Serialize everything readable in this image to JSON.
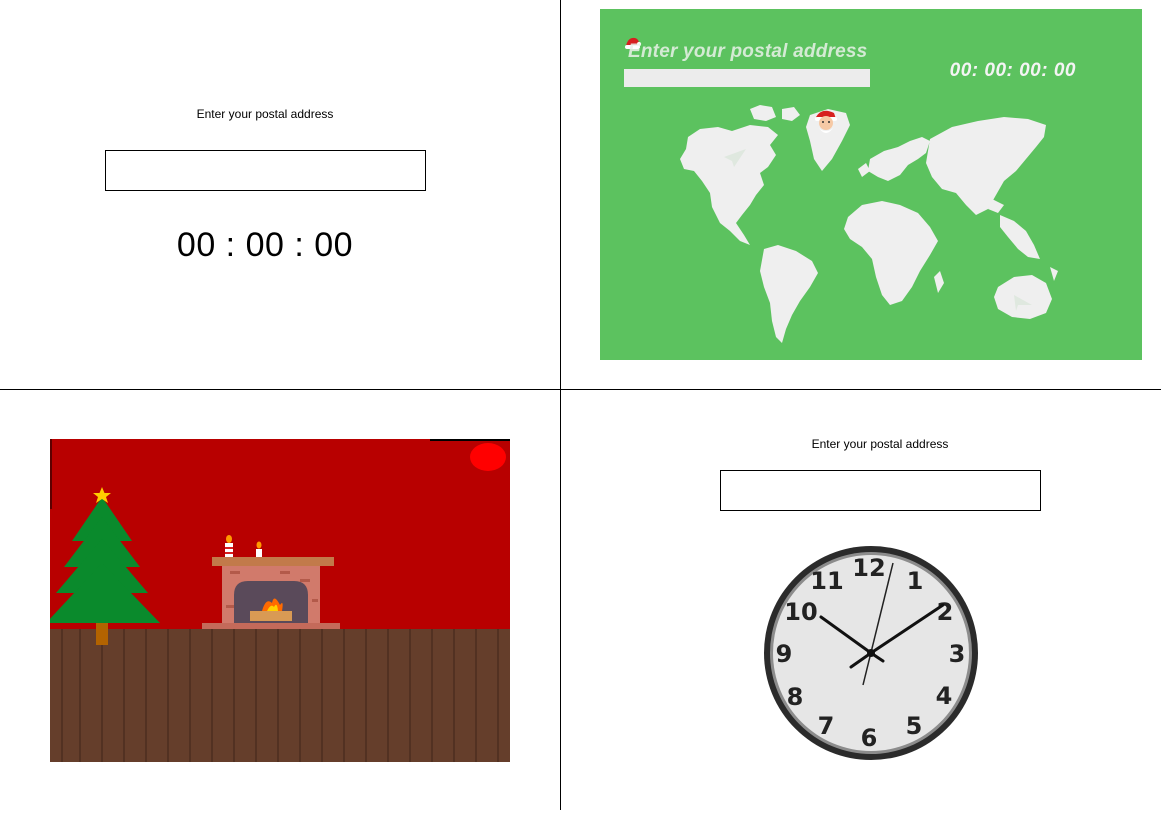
{
  "panel1": {
    "label": "Enter your postal address",
    "input_value": "",
    "timer": "00 : 00 : 00"
  },
  "panel2": {
    "label": "Enter your postal address",
    "timer": "00: 00: 00: 00",
    "background_color": "#5cc25f",
    "icons": [
      "santa-hat-icon",
      "santa-face-icon",
      "paper-plane-icon"
    ]
  },
  "panel3": {
    "wall_color": "#b80000",
    "floor_color": "#653e2b",
    "icons": [
      "christmas-tree-icon",
      "star-icon",
      "fireplace-icon",
      "candle-icon",
      "red-ornament-icon"
    ]
  },
  "panel4": {
    "label": "Enter your postal address",
    "input_value": "",
    "clock_numbers": [
      "12",
      "1",
      "2",
      "3",
      "4",
      "5",
      "6",
      "7",
      "8",
      "9",
      "10",
      "11"
    ]
  }
}
